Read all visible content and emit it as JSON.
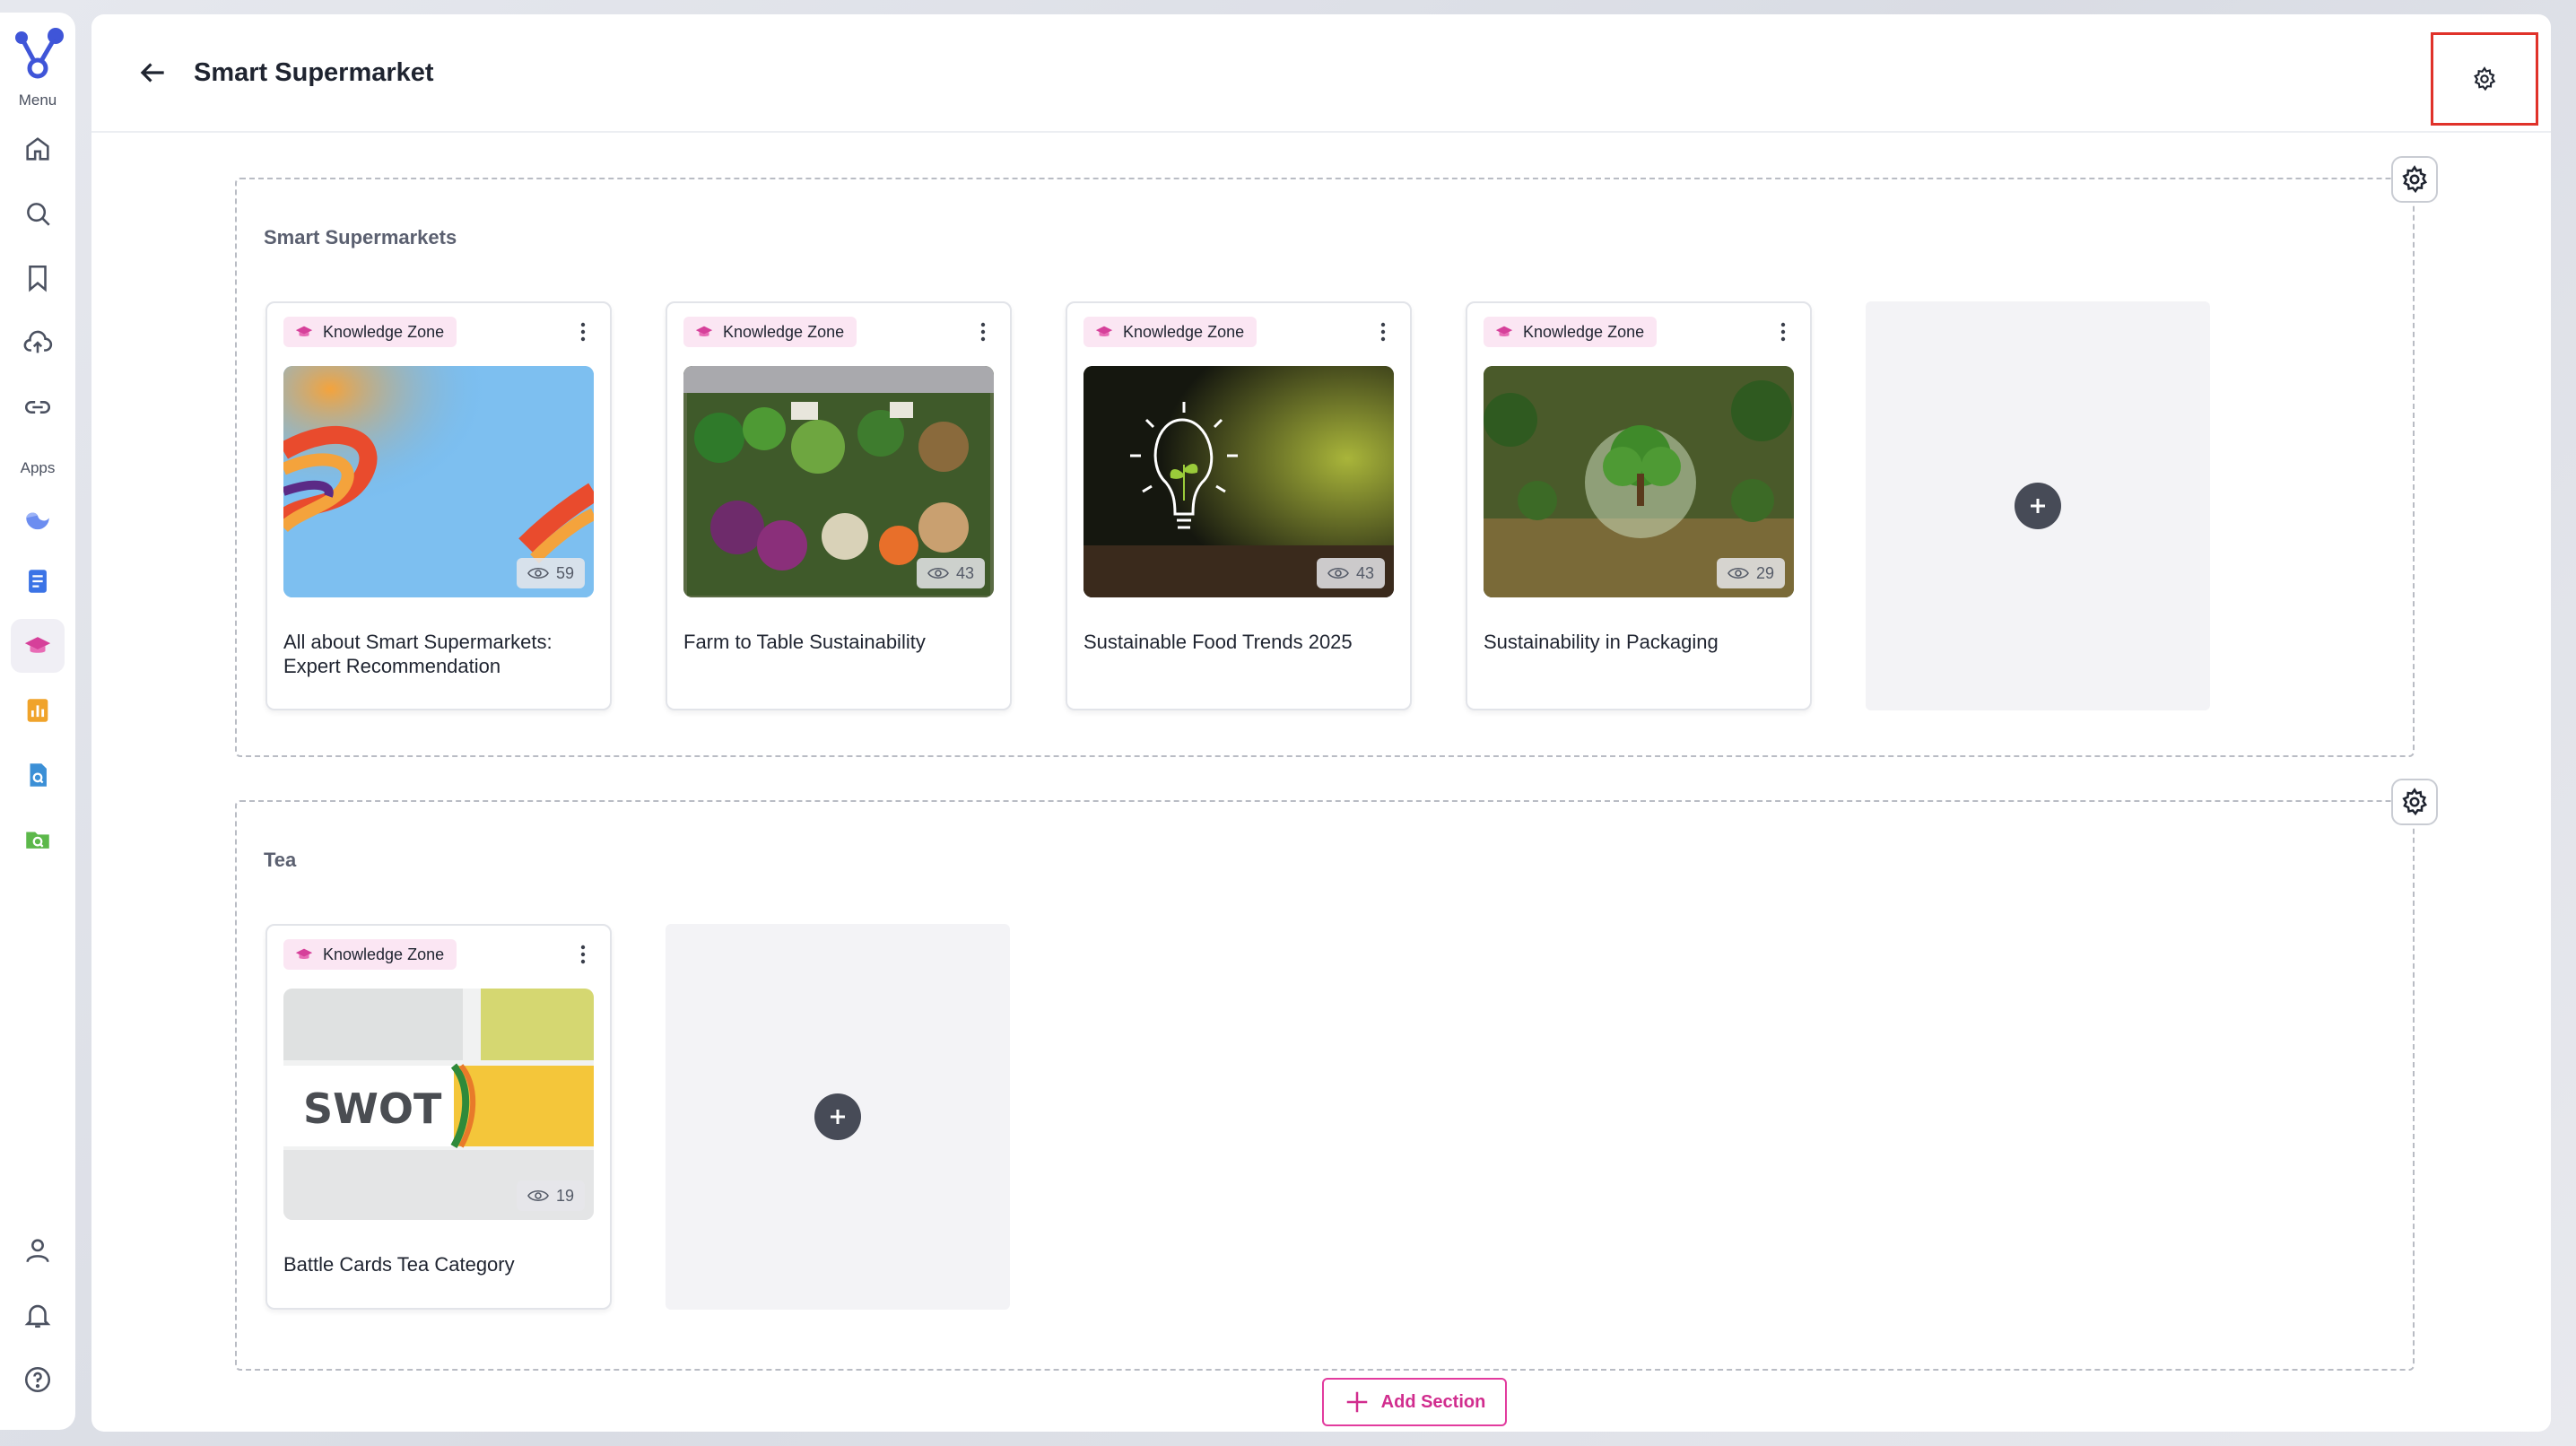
{
  "sidebar": {
    "menu_label": "Menu",
    "apps_label": "Apps",
    "menu_items": [
      "home",
      "search",
      "bookmark",
      "upload",
      "link"
    ],
    "app_items": [
      "cloud-app",
      "docs-app",
      "knowledge-zone-app",
      "analytics-app",
      "file-search-app",
      "folder-search-app"
    ],
    "bottom_items": [
      "profile",
      "notifications",
      "help"
    ]
  },
  "header": {
    "title": "Smart Supermarket"
  },
  "sections": [
    {
      "title": "Smart Supermarkets",
      "cards": [
        {
          "badge": "Knowledge Zone",
          "views": "59",
          "title": "All about Smart Supermarkets: Expert Recommendation"
        },
        {
          "badge": "Knowledge Zone",
          "views": "43",
          "title": "Farm to Table Sustainability"
        },
        {
          "badge": "Knowledge Zone",
          "views": "43",
          "title": "Sustainable Food Trends 2025"
        },
        {
          "badge": "Knowledge Zone",
          "views": "29",
          "title": "Sustainability in Packaging"
        }
      ]
    },
    {
      "title": "Tea",
      "cards": [
        {
          "badge": "Knowledge Zone",
          "views": "19",
          "title": "Battle Cards Tea Category",
          "thumb_text": "SWOT"
        }
      ]
    }
  ],
  "add_section_label": "Add Section",
  "colors": {
    "accent": "#d12d8e",
    "highlight_box": "#e0322a",
    "badge_bg": "#fbe6f3"
  }
}
